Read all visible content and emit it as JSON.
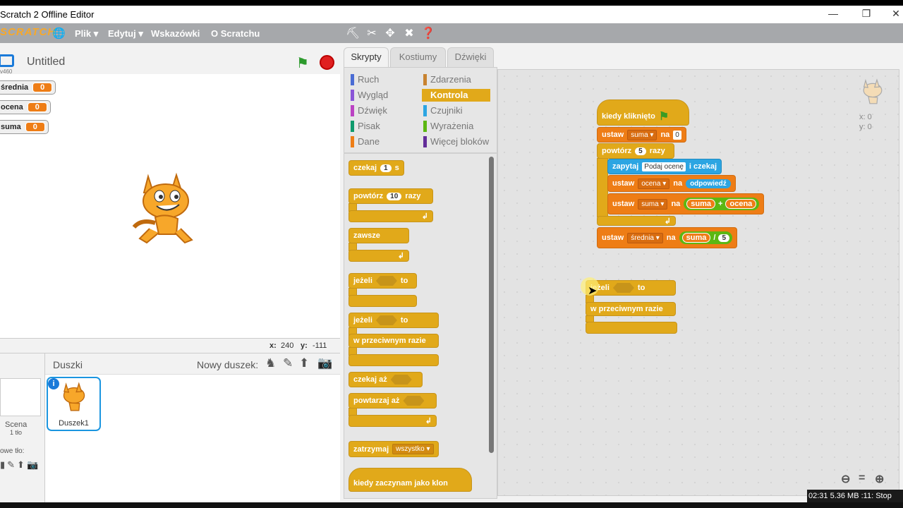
{
  "window": {
    "title": "Scratch 2 Offline Editor",
    "minimize": "—",
    "restore": "❐",
    "close": "✕"
  },
  "menubar": {
    "logo": "SCRATCH",
    "items": [
      "Plik ▾",
      "Edytuj ▾",
      "Wskazówki",
      "O Scratchu"
    ],
    "tools": [
      "duplicate-icon",
      "cut-icon",
      "grow-icon",
      "shrink-icon",
      "help-icon"
    ]
  },
  "stage": {
    "version": "v460",
    "project_title": "Untitled",
    "variables": [
      {
        "name": "średnia",
        "value": "0"
      },
      {
        "name": "ocena",
        "value": "0"
      },
      {
        "name": "suma",
        "value": "0"
      }
    ],
    "coords": {
      "x_label": "x:",
      "x": "240",
      "y_label": "y:",
      "y": "-111"
    }
  },
  "sprites": {
    "header": "Duszki",
    "new_sprite": "Nowy duszek:",
    "stage_label": "Scena",
    "stage_backdrops": "1 tło",
    "new_backdrop": "owe tło:",
    "items": [
      {
        "name": "Duszek1"
      }
    ]
  },
  "tabs": [
    "Skrypty",
    "Kostiumy",
    "Dźwięki"
  ],
  "categories": [
    {
      "label": "Ruch",
      "color": "#4a6cd4"
    },
    {
      "label": "Zdarzenia",
      "color": "#c88330"
    },
    {
      "label": "Wygląd",
      "color": "#8a55d7"
    },
    {
      "label": "Kontrola",
      "color": "#e1a91a"
    },
    {
      "label": "Dźwięk",
      "color": "#bb42c3"
    },
    {
      "label": "Czujniki",
      "color": "#2ca5e2"
    },
    {
      "label": "Pisak",
      "color": "#0e9a6c"
    },
    {
      "label": "Wyrażenia",
      "color": "#5cb712"
    },
    {
      "label": "Dane",
      "color": "#ee7d16"
    },
    {
      "label": "Więcej bloków",
      "color": "#632d99"
    }
  ],
  "palette": {
    "czekaj": "czekaj",
    "czekaj_val": "1",
    "czekaj_unit": "s",
    "powtorz": "powtórz",
    "powtorz_val": "10",
    "powtorz_unit": "razy",
    "zawsze": "zawsze",
    "jezeli": "jeżeli",
    "to": "to",
    "w_przeciwnym": "w przeciwnym razie",
    "czekaj_az": "czekaj aż",
    "powtarzaj_az": "powtarzaj aż",
    "zatrzymaj": "zatrzymaj",
    "zatrzymaj_val": "wszystko ▾",
    "klon": "kiedy zaczynam jako klon"
  },
  "script": {
    "hat": "kiedy kliknięto",
    "ustaw": "ustaw",
    "na": "na",
    "suma_var": "suma ▾",
    "suma_val": "0",
    "powtorz": "powtórz",
    "powtorz_val": "5",
    "razy": "razy",
    "zapytaj": "zapytaj",
    "zapytaj_val": "Podaj ocenę",
    "i_czekaj": "i czekaj",
    "ocena_var": "ocena ▾",
    "odpowiedz": "odpowiedź",
    "suma_rep": "suma",
    "plus": "+",
    "ocena_rep": "ocena",
    "srednia_var": "średnia ▾",
    "div": "/",
    "div_val": "5",
    "if_label": "jeżeli",
    "if_to": "to",
    "else_label": "w przeciwnym razie"
  },
  "sprite_xy": {
    "x": "x: 0",
    "y": "y: 0"
  },
  "taskbar": "02:31 5.36 MB :11: Stop"
}
